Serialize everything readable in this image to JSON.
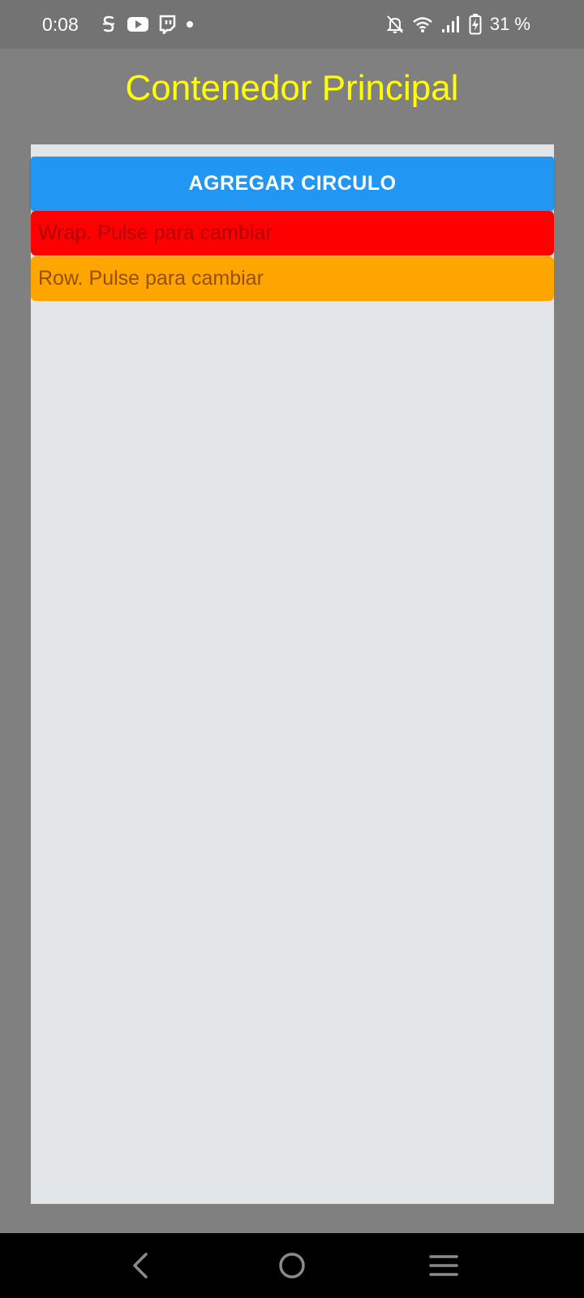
{
  "status_bar": {
    "time": "0:08",
    "left_icons": [
      "s-app-icon",
      "youtube-icon",
      "twitch-icon",
      "dot-icon"
    ],
    "right_icons": [
      "bell-off-icon",
      "wifi-icon",
      "signal-icon",
      "battery-charging-icon"
    ],
    "battery_percent": "31 %"
  },
  "title": "Contenedor Principal",
  "main": {
    "add_button_label": "AGREGAR CIRCULO",
    "wrap_toggle_label": "Wrap. Pulse para cambiar",
    "row_toggle_label": "Row. Pulse para cambiar"
  },
  "nav_bar": {
    "buttons": [
      "back-icon",
      "home-icon",
      "menu-icon"
    ]
  },
  "colors": {
    "background": "#808080",
    "status_bar": "#737373",
    "title": "#ffff00",
    "container": "#e2e6e8",
    "add_button": "#2196f3",
    "wrap_toggle": "#ff0000",
    "row_toggle": "#ffa500",
    "nav_bar": "#000000"
  }
}
